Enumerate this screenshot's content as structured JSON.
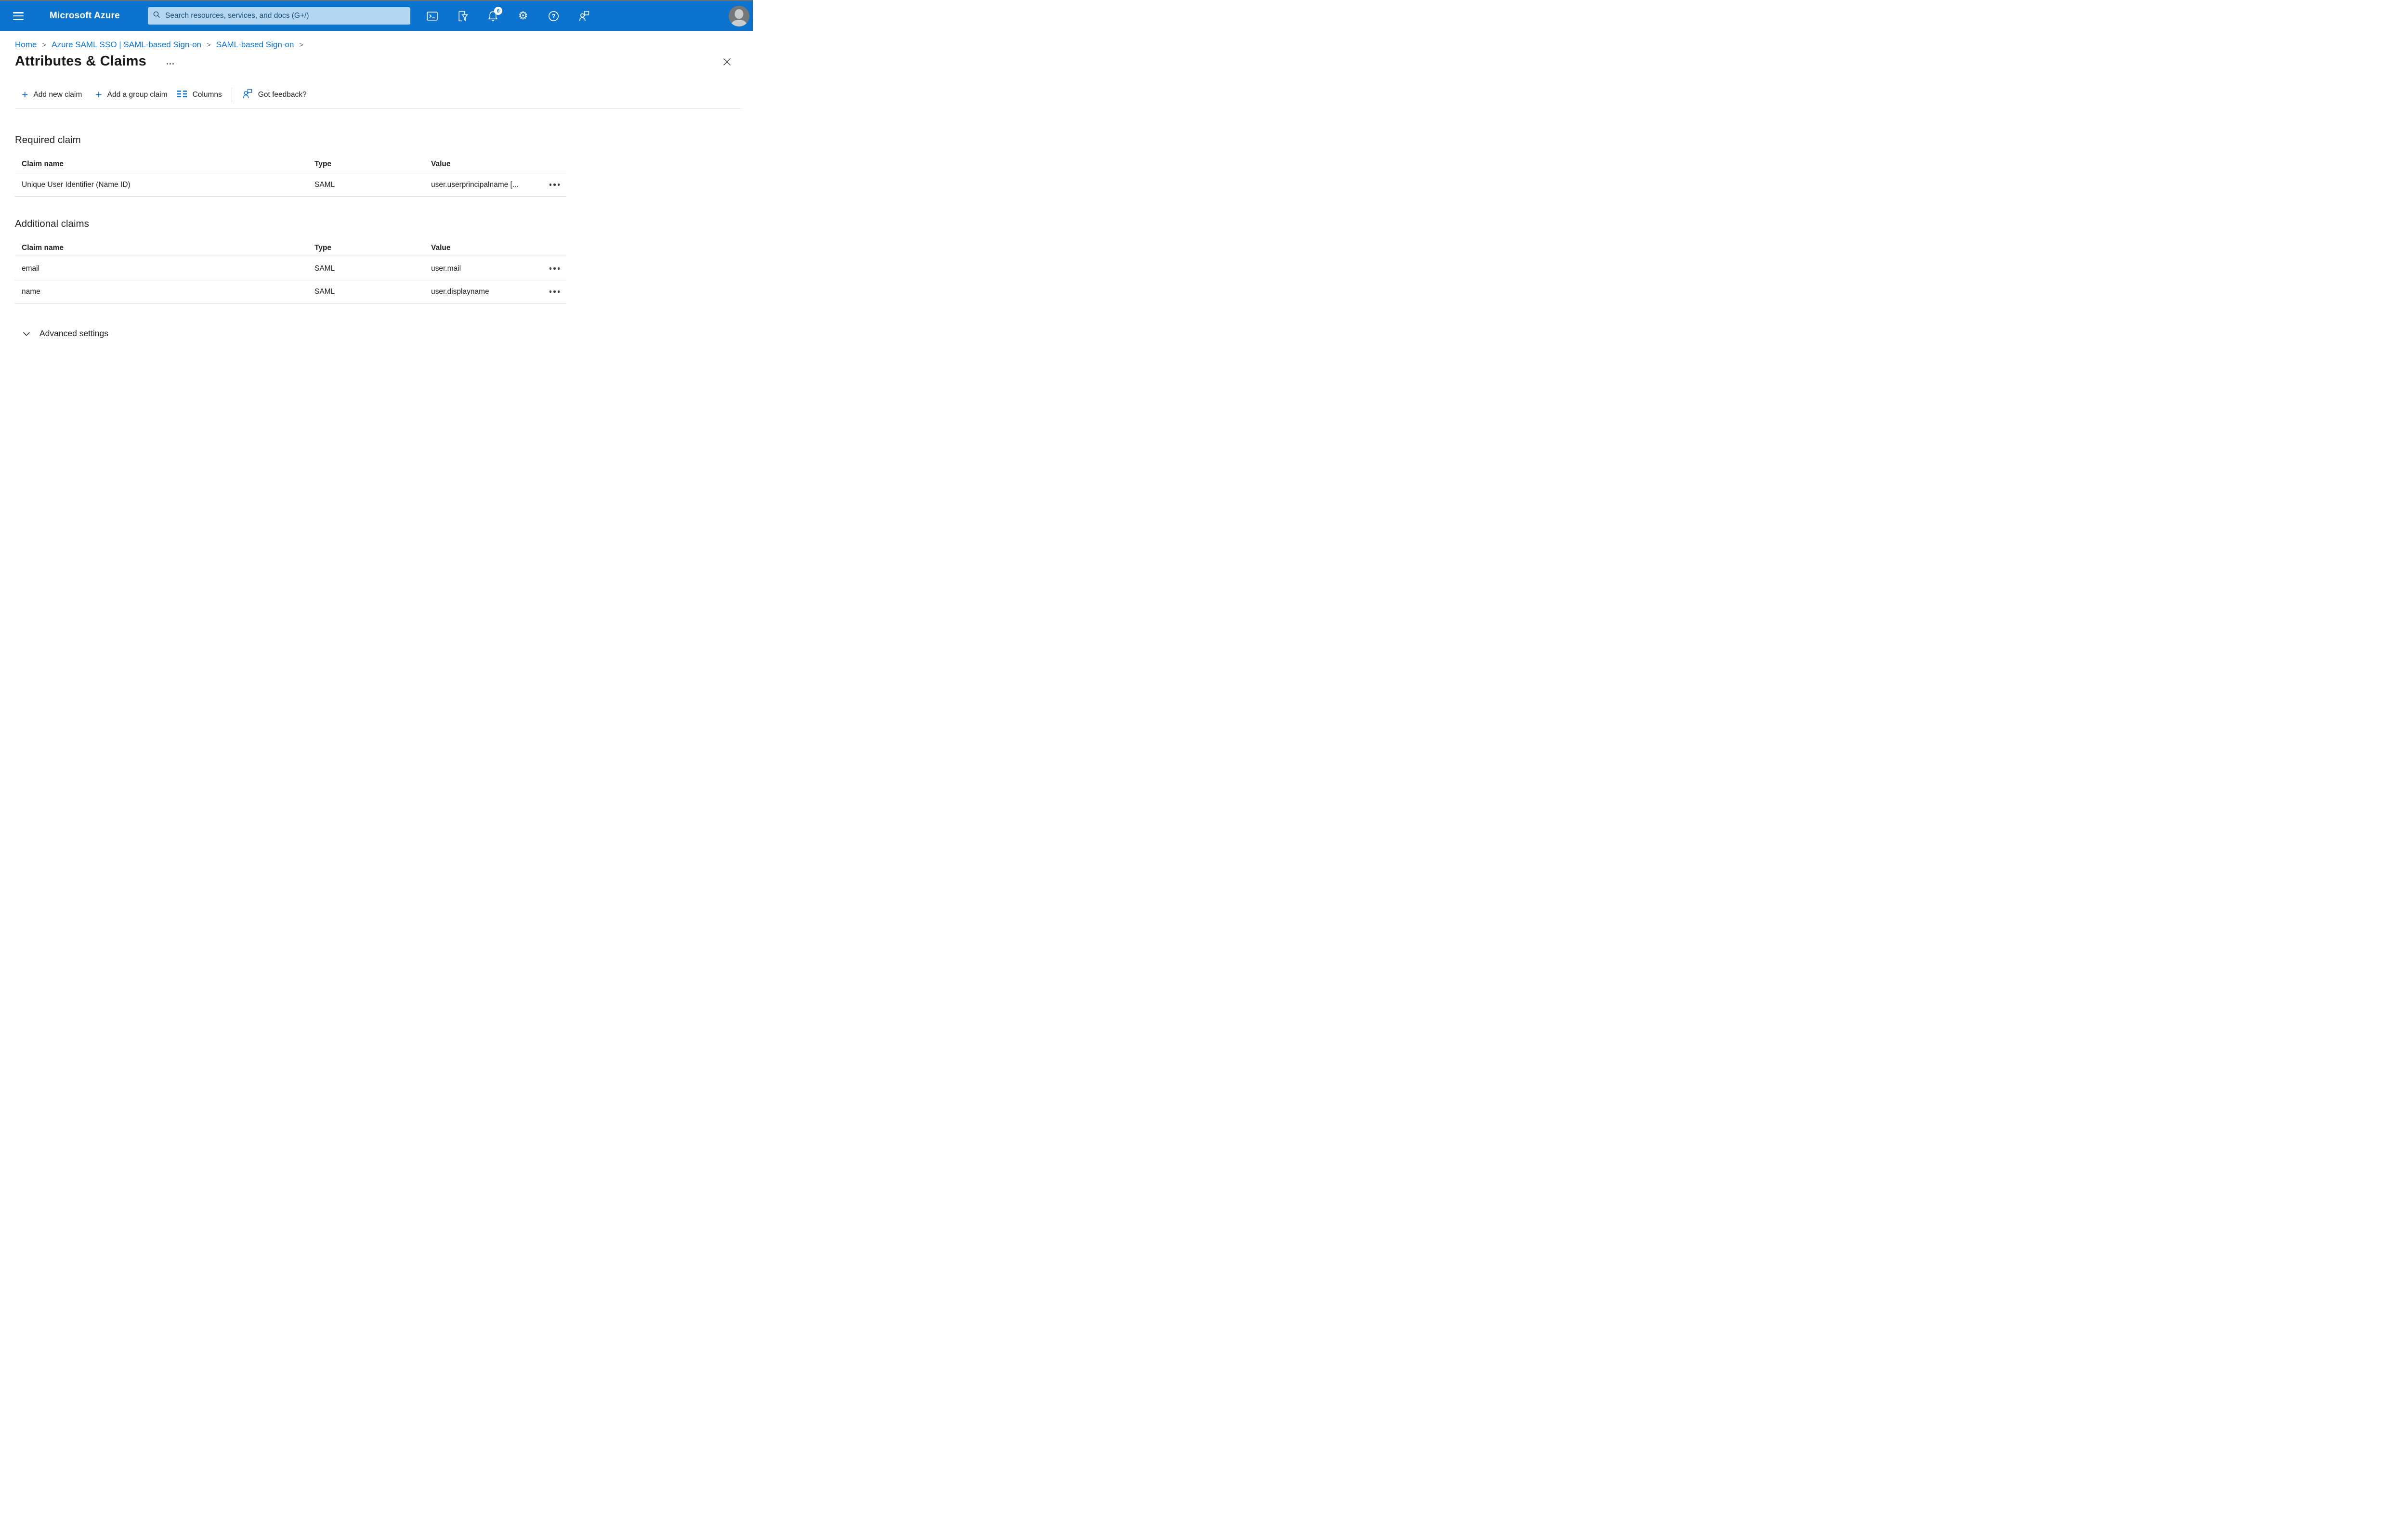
{
  "colors": {
    "topbar": "#0c74ce",
    "accent": "#0c74ce",
    "link": "#0c74ce",
    "search_bg": "#b4d6f0",
    "search_text": "#1b4e79",
    "badge_bg": "#ffffff",
    "badge_text": "#0c74ce",
    "row_border": "#cfcdcb",
    "header_border": "#edebe9"
  },
  "topbar": {
    "brand": "Microsoft Azure",
    "search_placeholder": "Search resources, services, and docs (G+/)",
    "notification_count": "6",
    "icon_names": [
      "hamburger-menu-icon",
      "search-icon",
      "cloud-shell-icon",
      "subscription-filter-icon",
      "notifications-bell-icon",
      "settings-gear-icon",
      "help-icon",
      "feedback-person-icon",
      "user-avatar"
    ]
  },
  "breadcrumb": {
    "separator": ">",
    "items": [
      {
        "label": "Home"
      },
      {
        "label": "Azure SAML SSO | SAML-based Sign-on"
      },
      {
        "label": "SAML-based Sign-on"
      }
    ]
  },
  "page": {
    "title": "Attributes & Claims",
    "icon_names": [
      "more-ellipsis-icon",
      "close-icon"
    ]
  },
  "toolbar": {
    "add_new_claim": "Add new claim",
    "add_group_claim": "Add a group claim",
    "columns": "Columns",
    "got_feedback": "Got feedback?",
    "icon_names": [
      "plus-icon",
      "plus-icon",
      "columns-icon",
      "feedback-person-icon"
    ]
  },
  "required_claim": {
    "heading": "Required claim",
    "columns": [
      "Claim name",
      "Type",
      "Value"
    ],
    "rows": [
      {
        "claim_name": "Unique User Identifier (Name ID)",
        "type": "SAML",
        "value": "user.userprincipalname [..."
      }
    ]
  },
  "additional_claims": {
    "heading": "Additional claims",
    "columns": [
      "Claim name",
      "Type",
      "Value"
    ],
    "rows": [
      {
        "claim_name": "email",
        "type": "SAML",
        "value": "user.mail"
      },
      {
        "claim_name": "name",
        "type": "SAML",
        "value": "user.displayname"
      }
    ]
  },
  "advanced": {
    "label": "Advanced settings",
    "icon_name": "chevron-down-icon"
  }
}
